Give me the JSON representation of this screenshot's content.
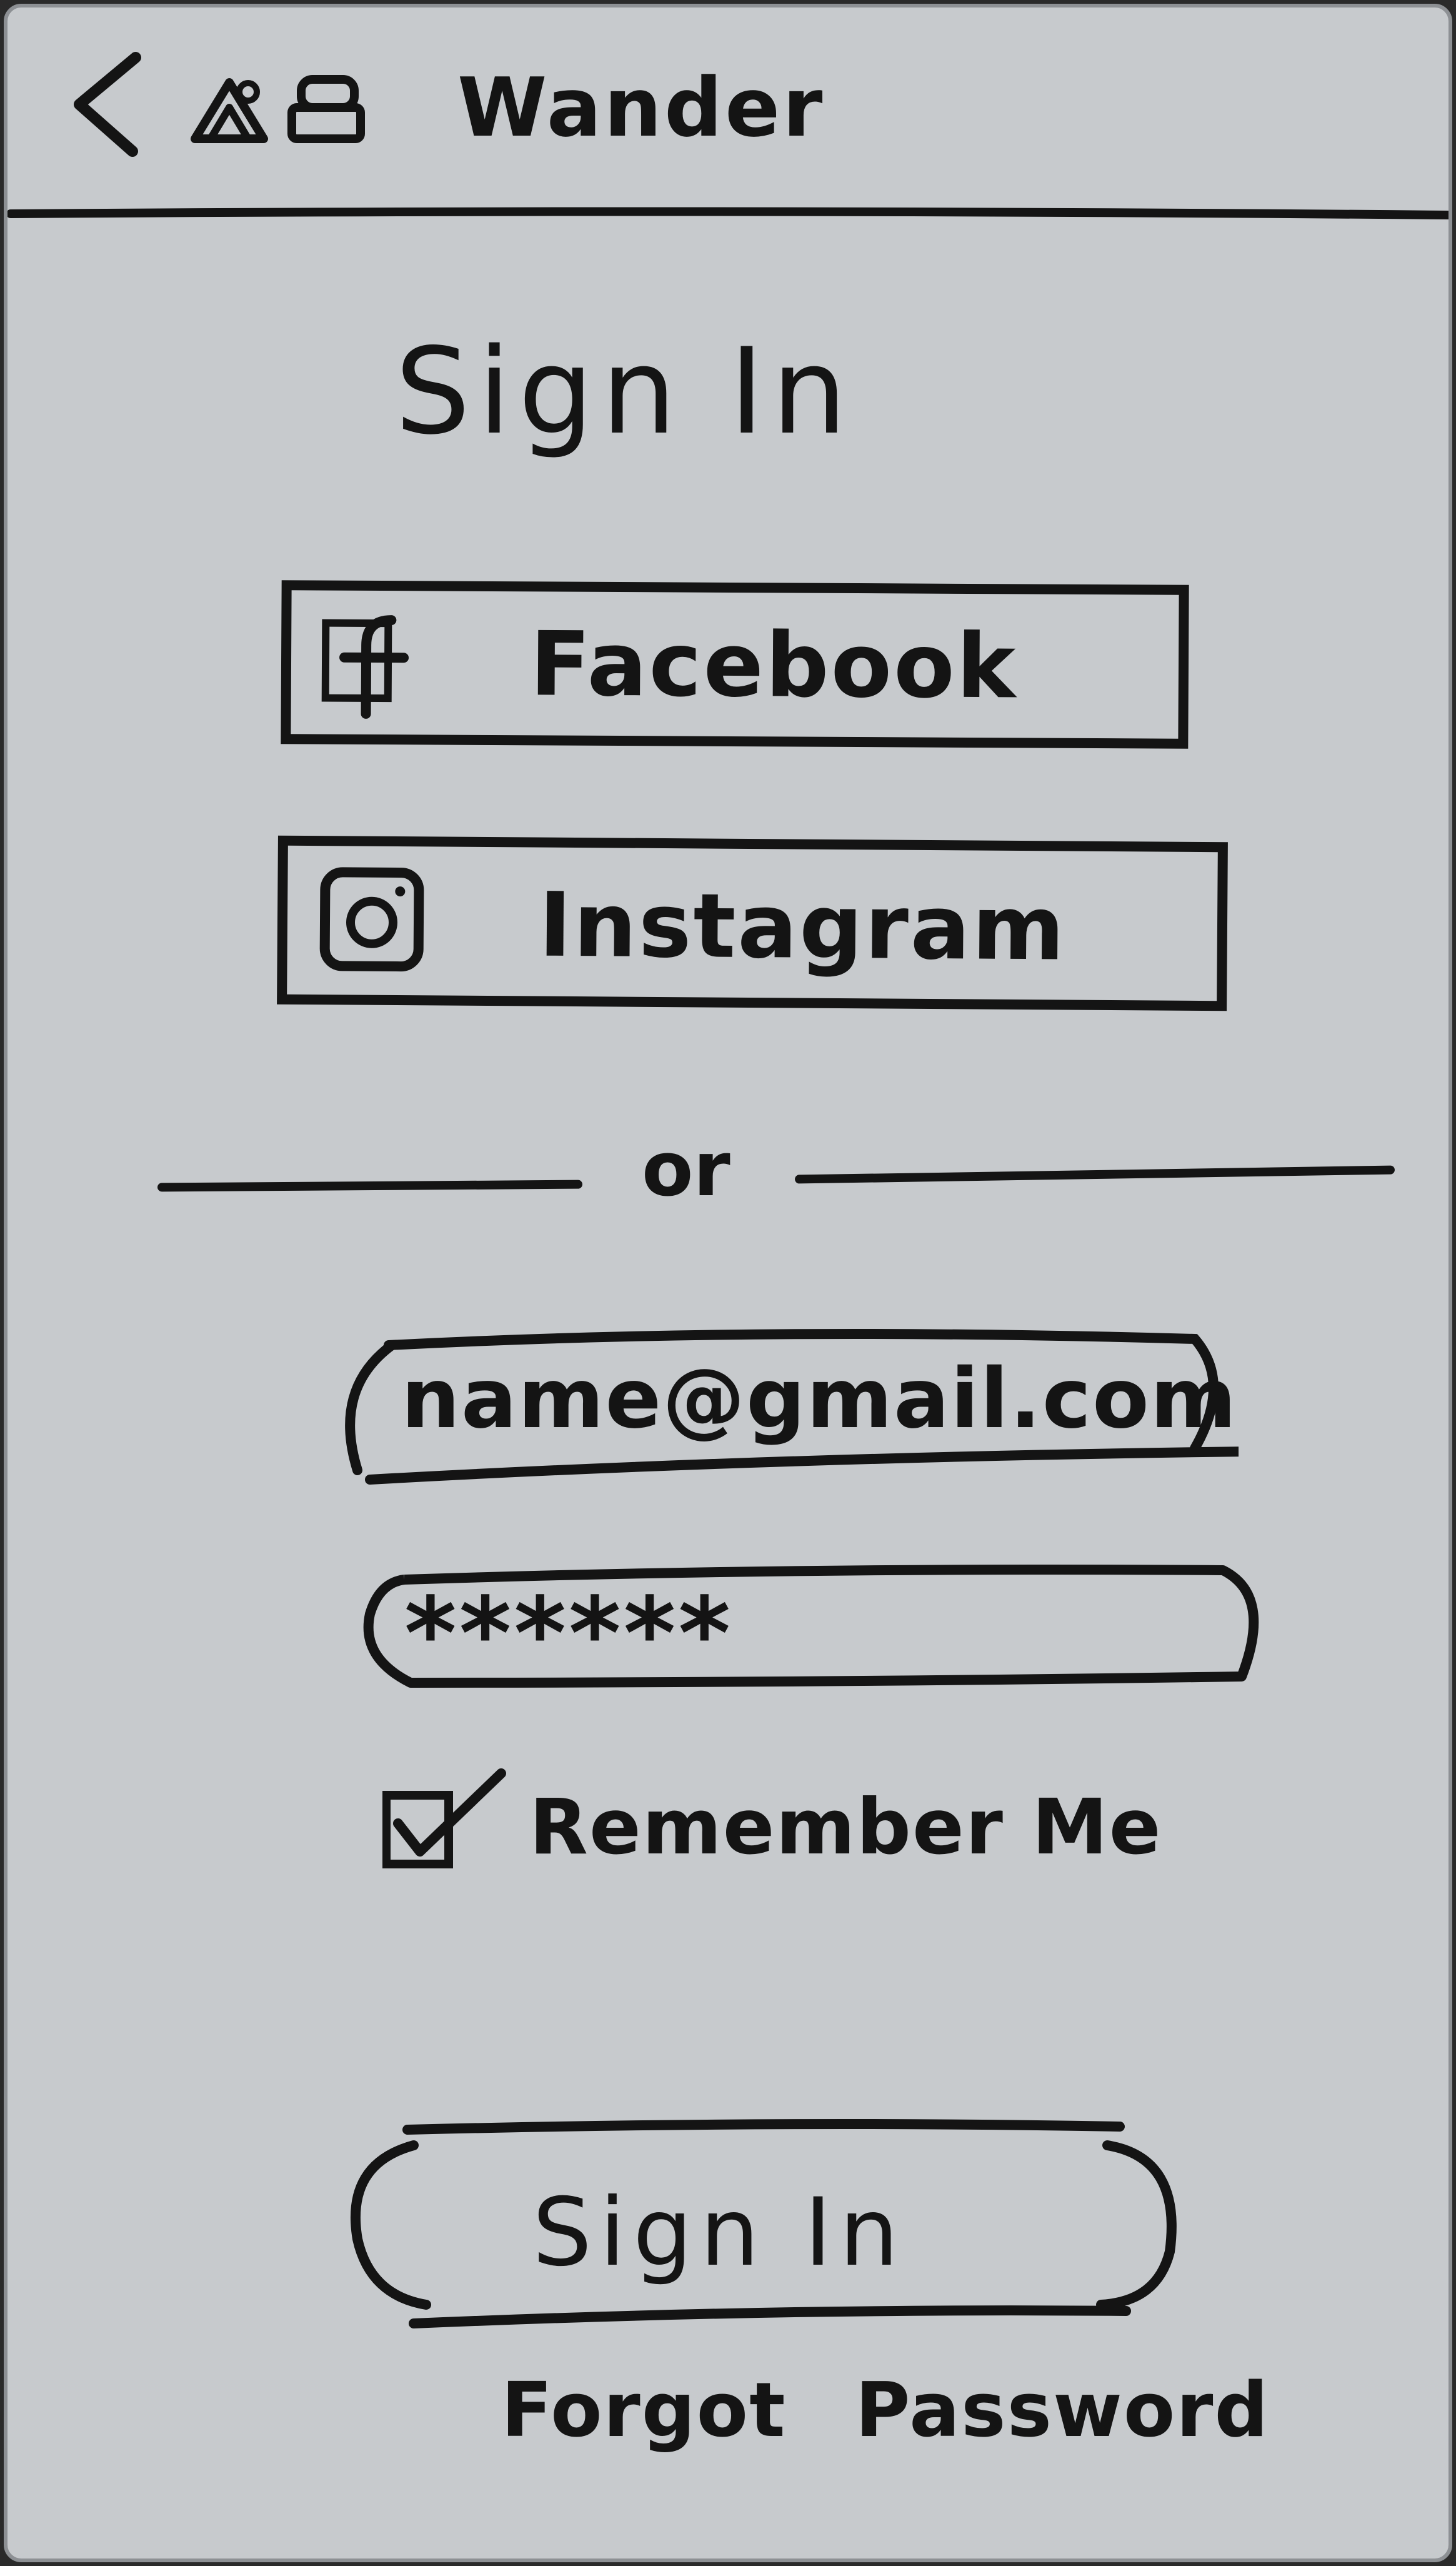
{
  "header": {
    "title": "Wander"
  },
  "page": {
    "title": "Sign In"
  },
  "social": {
    "facebook_label": "Facebook",
    "instagram_label": "Instagram"
  },
  "divider": {
    "text": "or"
  },
  "form": {
    "email_value": "name@gmail.com",
    "password_value": "******",
    "remember_label": "Remember Me",
    "remember_checked": true
  },
  "actions": {
    "signin_label": "Sign In",
    "forgot_word1": "Forgot",
    "forgot_word2": "Password"
  },
  "icons": {
    "back": "chevron-left-icon",
    "logo": "wander-logo-icon",
    "facebook": "facebook-icon",
    "instagram": "instagram-icon",
    "checkbox": "checkbox-checked-icon"
  },
  "colors": {
    "ink": "#141414",
    "paper": "#c7cacd"
  }
}
